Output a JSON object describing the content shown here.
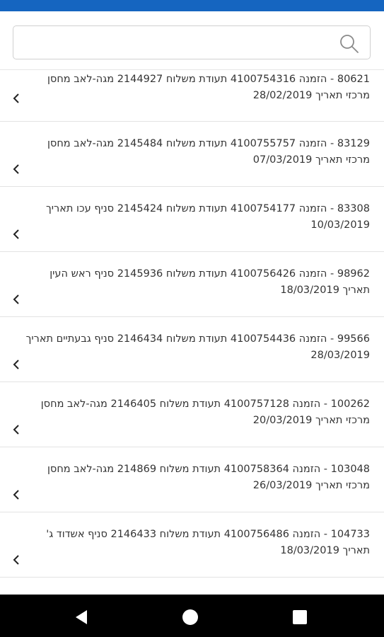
{
  "search": {
    "placeholder": "",
    "value": ""
  },
  "list": {
    "items": [
      {
        "text": "80621 - הזמנה 4100754316 תעודת משלוח 2144927 מגה-לאב מחסן מרכזי תאריך 28/02/2019"
      },
      {
        "text": "83129 - הזמנה 4100755757 תעודת משלוח 2145484 מגה-לאב מחסן מרכזי תאריך 07/03/2019"
      },
      {
        "text": "83308 - הזמנה 4100754177 תעודת משלוח 2145424 סניף עכו תאריך 10/03/2019"
      },
      {
        "text": "98962 - הזמנה 4100756426 תעודת משלוח 2145936 סניף ראש העין תאריך 18/03/2019"
      },
      {
        "text": "99566 - הזמנה 4100754436 תעודת משלוח 2146434 סניף גבעתיים תאריך 28/03/2019"
      },
      {
        "text": "100262 - הזמנה 4100757128 תעודת משלוח 2146405 מגה-לאב מחסן מרכזי תאריך 20/03/2019"
      },
      {
        "text": "103048 - הזמנה 4100758364 תעודת משלוח 214869 מגה-לאב מחסן מרכזי תאריך 26/03/2019"
      },
      {
        "text": "104733 - הזמנה 4100756486 תעודת משלוח 2146433 סניף אשדוד ג' תאריך 18/03/2019"
      }
    ]
  },
  "icons": {
    "search": "search-icon",
    "chevron": "chevron-left-icon",
    "back": "back-triangle-icon",
    "home": "home-circle-icon",
    "recent": "recent-square-icon"
  },
  "colors": {
    "top_bar": "#1565c0",
    "text": "#333333",
    "divider": "#e3e3e3",
    "nav_bar": "#000000"
  }
}
